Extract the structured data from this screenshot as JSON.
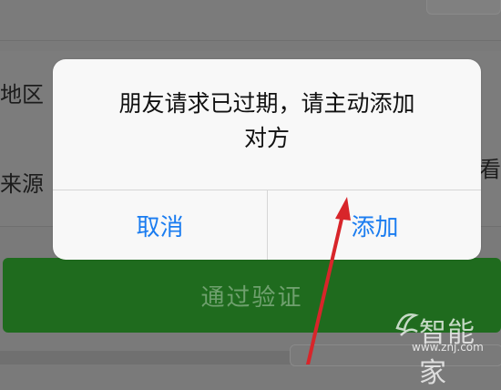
{
  "background": {
    "region_label": "地区",
    "source_label": "来源",
    "right_text": "眼看",
    "verify_button": "通过验证"
  },
  "dialog": {
    "message_line1": "朋友请求已过期，请主动添加",
    "message_line2": "对方",
    "cancel_label": "取消",
    "add_label": "添加",
    "accent_color": "#1a7cf0"
  },
  "watermark": {
    "brand": "智能家",
    "url": "www.znj.com"
  },
  "colors": {
    "verify_green": "#1f6b1e",
    "arrow_red": "#d8252a"
  }
}
